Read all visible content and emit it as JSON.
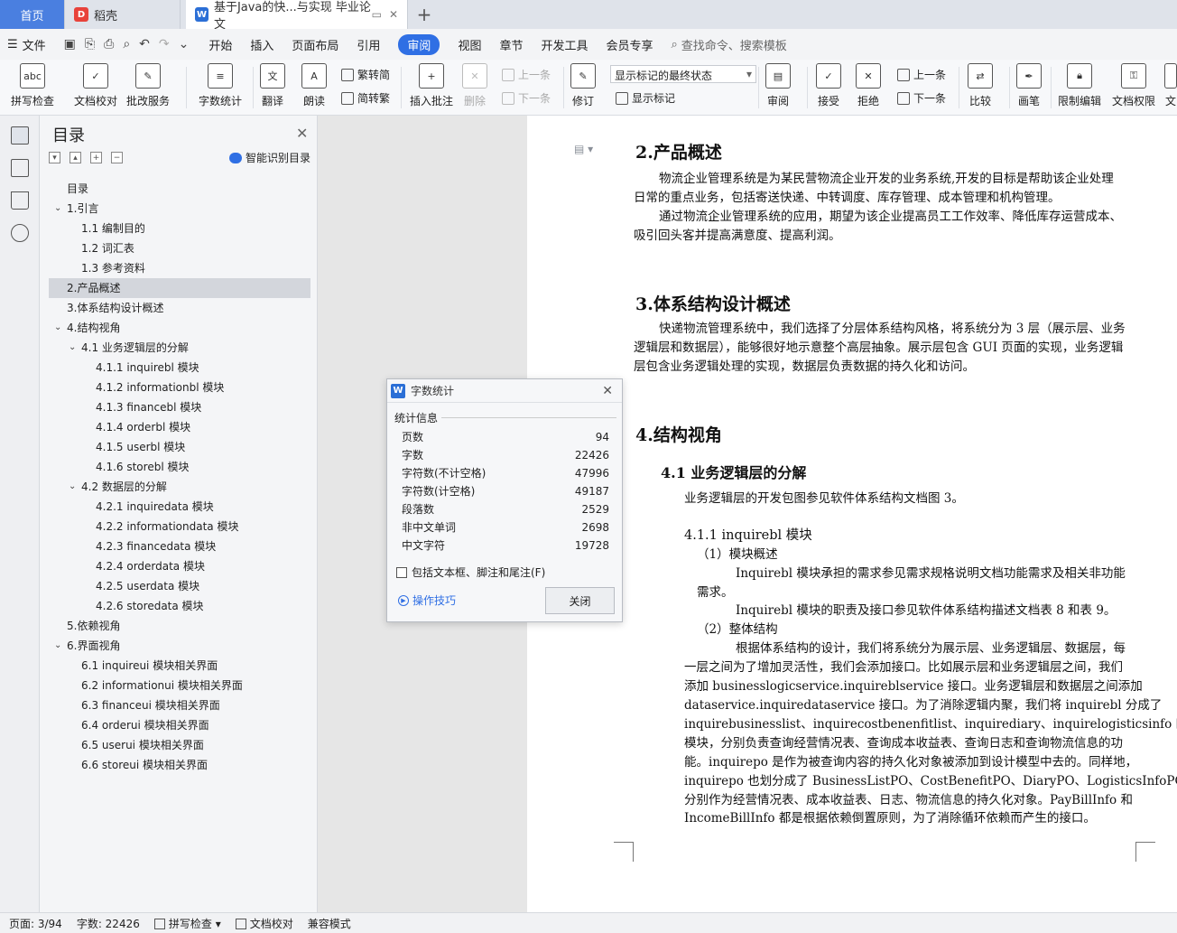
{
  "tabs": {
    "home": "首页",
    "daoke": "稻壳",
    "doc": "基于Java的快...与实现 毕业论文",
    "add": "+"
  },
  "menu": {
    "file": "文件",
    "items": [
      "开始",
      "插入",
      "页面布局",
      "引用",
      "审阅",
      "视图",
      "章节",
      "开发工具",
      "会员专享"
    ],
    "active": "审阅",
    "search": "查找命令、搜索模板"
  },
  "ribbon": {
    "spellcheck": "拼写检查",
    "doccheck": "文档校对",
    "review_service": "批改服务",
    "wordcount": "字数统计",
    "translate": "翻译",
    "read_aloud": "朗读",
    "to_traditional": "繁转简",
    "to_simplified": "简转繁",
    "insert_comment": "插入批注",
    "delete": "删除",
    "prev_comment": "上一条",
    "next_comment": "下一条",
    "track": "修订",
    "display_mode": "显示标记的最终状态",
    "show_markup": "显示标记",
    "review": "审阅",
    "accept": "接受",
    "reject": "拒绝",
    "prev_change": "上一条",
    "next_change": "下一条",
    "compare": "比较",
    "pen": "画笔",
    "restrict_edit": "限制编辑",
    "doc_permission": "文档权限",
    "overflow": "文"
  },
  "toc": {
    "title": "目录",
    "smart": "智能识别目录",
    "items": [
      {
        "text": "目录",
        "level": 0,
        "chevron": ""
      },
      {
        "text": "1.引言",
        "level": 0,
        "chevron": "open"
      },
      {
        "text": "1.1 编制目的",
        "level": 1,
        "chevron": ""
      },
      {
        "text": "1.2 词汇表",
        "level": 1,
        "chevron": ""
      },
      {
        "text": "1.3 参考资料",
        "level": 1,
        "chevron": ""
      },
      {
        "text": "2.产品概述",
        "level": 0,
        "chevron": "",
        "selected": true
      },
      {
        "text": "3.体系结构设计概述",
        "level": 0,
        "chevron": ""
      },
      {
        "text": "4.结构视角",
        "level": 0,
        "chevron": "open"
      },
      {
        "text": "4.1 业务逻辑层的分解",
        "level": 1,
        "chevron": "open"
      },
      {
        "text": "4.1.1 inquirebl 模块",
        "level": 2,
        "chevron": ""
      },
      {
        "text": "4.1.2 informationbl 模块",
        "level": 2,
        "chevron": ""
      },
      {
        "text": "4.1.3 financebl 模块",
        "level": 2,
        "chevron": ""
      },
      {
        "text": "4.1.4 orderbl 模块",
        "level": 2,
        "chevron": ""
      },
      {
        "text": "4.1.5 userbl 模块",
        "level": 2,
        "chevron": ""
      },
      {
        "text": "4.1.6 storebl 模块",
        "level": 2,
        "chevron": ""
      },
      {
        "text": "4.2  数据层的分解",
        "level": 1,
        "chevron": "open"
      },
      {
        "text": "4.2.1 inquiredata 模块",
        "level": 2,
        "chevron": ""
      },
      {
        "text": "4.2.2 informationdata 模块",
        "level": 2,
        "chevron": ""
      },
      {
        "text": "4.2.3 financedata 模块",
        "level": 2,
        "chevron": ""
      },
      {
        "text": "4.2.4 orderdata 模块",
        "level": 2,
        "chevron": ""
      },
      {
        "text": "4.2.5 userdata 模块",
        "level": 2,
        "chevron": ""
      },
      {
        "text": "4.2.6 storedata 模块",
        "level": 2,
        "chevron": ""
      },
      {
        "text": "5.依赖视角",
        "level": 0,
        "chevron": ""
      },
      {
        "text": "6.界面视角",
        "level": 0,
        "chevron": "open"
      },
      {
        "text": "6.1 inquireui 模块相关界面",
        "level": 1,
        "chevron": ""
      },
      {
        "text": "6.2 informationui 模块相关界面",
        "level": 1,
        "chevron": ""
      },
      {
        "text": "6.3 financeui 模块相关界面",
        "level": 1,
        "chevron": ""
      },
      {
        "text": "6.4 orderui 模块相关界面",
        "level": 1,
        "chevron": ""
      },
      {
        "text": "6.5 userui 模块相关界面",
        "level": 1,
        "chevron": ""
      },
      {
        "text": "6.6 storeui 模块相关界面",
        "level": 1,
        "chevron": ""
      }
    ]
  },
  "dialog": {
    "title": "字数统计",
    "section": "统计信息",
    "rows": [
      {
        "label": "页数",
        "value": "94"
      },
      {
        "label": "字数",
        "value": "22426"
      },
      {
        "label": "字符数(不计空格)",
        "value": "47996"
      },
      {
        "label": "字符数(计空格)",
        "value": "49187"
      },
      {
        "label": "段落数",
        "value": "2529"
      },
      {
        "label": "非中文单词",
        "value": "2698"
      },
      {
        "label": "中文字符",
        "value": "19728"
      }
    ],
    "checkbox": "包括文本框、脚注和尾注(F)",
    "tips": "操作技巧",
    "close": "关闭"
  },
  "document": {
    "h2": "2.产品概述",
    "p2a_1": "物流企业管理系统是为某民营物流企业开发的业务系统,开发的目标是帮助该企业处理",
    "p2a_2": "日常的重点业务，包括寄送快递、中转调度、库存管理、成本管理和机构管理。",
    "p2b_1": "通过物流企业管理系统的应用，期望为该企业提高员工工作效率、降低库存运营成本、",
    "p2b_2": "吸引回头客并提高满意度、提高利润。",
    "h3": "3.体系结构设计概述",
    "p3_1": "快递物流管理系统中，我们选择了分层体系结构风格，将系统分为 3 层（展示层、业务",
    "p3_2": "逻辑层和数据层），能够很好地示意整个高层抽象。展示层包含 GUI 页面的实现，业务逻辑",
    "p3_3": "层包含业务逻辑处理的实现，数据层负责数据的持久化和访问。",
    "h4": "4.结构视角",
    "h41": "4.1 业务逻辑层的分解",
    "p41": "业务逻辑层的开发包图参见软件体系结构文档图 3。",
    "h411": "4.1.1 inquirebl 模块",
    "s1": "（1）模块概述",
    "s1a_1": "Inquirebl 模块承担的需求参见需求规格说明文档功能需求及相关非功能",
    "s1a_2": "需求。",
    "s1b": "Inquirebl 模块的职责及接口参见软件体系结构描述文档表 8 和表 9。",
    "s2": "（2）整体结构",
    "s2a_1": "根据体系结构的设计，我们将系统分为展示层、业务逻辑层、数据层，每",
    "s2a_2": "一层之间为了增加灵活性，我们会添加接口。比如展示层和业务逻辑层之间，我们",
    "s2a_3": "添加 businesslogicservice.inquireblservice 接口。业务逻辑层和数据层之间添加",
    "s2a_4": "dataservice.inquiredataservice 接口。为了消除逻辑内聚，我们将 inquirebl 分成了",
    "s2a_5": "inquirebusinesslist、inquirecostbenenfitlist、inquirediary、inquirelogisticsinfo 四个子",
    "s2a_6": "模块，分别负责查询经营情况表、查询成本收益表、查询日志和查询物流信息的功",
    "s2a_7": "能。inquirepo 是作为被查询内容的持久化对象被添加到设计模型中去的。同样地，",
    "s2a_8": "inquirepo 也划分成了 BusinessListPO、CostBenefitPO、DiaryPO、LogisticsInfoPO，",
    "s2a_9": "分别作为经营情况表、成本收益表、日志、物流信息的持久化对象。PayBillInfo 和",
    "s2a_10": "IncomeBillInfo 都是根据依赖倒置原则，为了消除循环依赖而产生的接口。"
  },
  "status": {
    "page": "页面: 3/94",
    "words": "字数: 22426",
    "spell": "拼写检查",
    "proof": "文档校对",
    "compat": "兼容模式"
  }
}
